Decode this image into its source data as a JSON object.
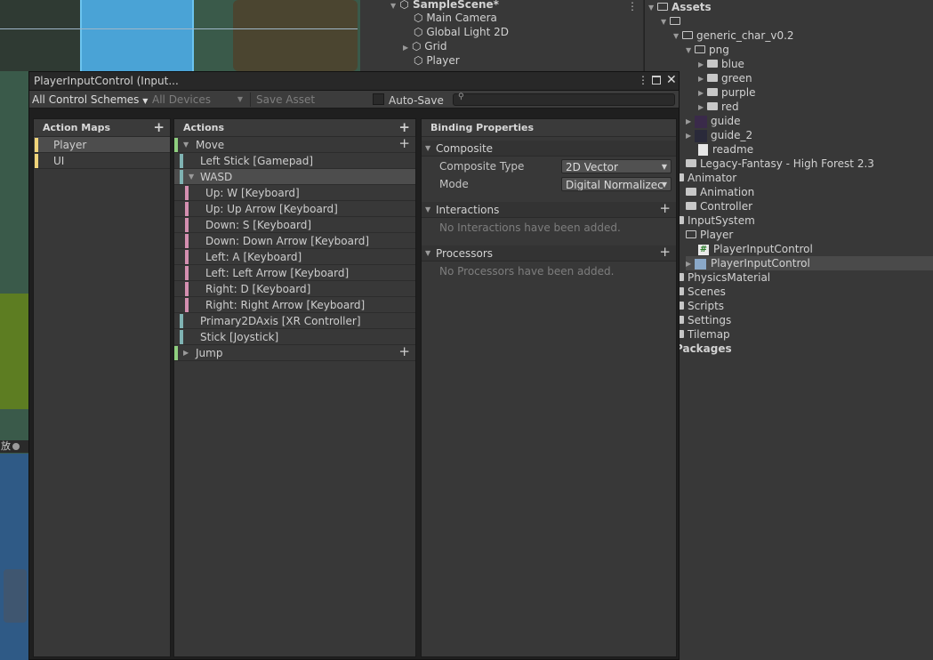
{
  "hierarchy": {
    "scene": "SampleScene*",
    "items": [
      "Main Camera",
      "Global Light 2D",
      "Grid",
      "Player"
    ]
  },
  "project": {
    "root": "Assets",
    "items": [
      {
        "label": ""
      },
      {
        "label": "generic_char_v0.2"
      },
      {
        "label": "png"
      },
      {
        "label": "blue"
      },
      {
        "label": "green"
      },
      {
        "label": "purple"
      },
      {
        "label": "red"
      },
      {
        "label": "guide"
      },
      {
        "label": "guide_2"
      },
      {
        "label": "readme"
      },
      {
        "label": "Legacy-Fantasy - High Forest 2.3"
      },
      {
        "label": "Animator"
      },
      {
        "label": "Animation"
      },
      {
        "label": "Controller"
      },
      {
        "label": "InputSystem"
      },
      {
        "label": "Player"
      },
      {
        "label": "PlayerInputControl"
      },
      {
        "label": "PlayerInputControl"
      },
      {
        "label": "PhysicsMaterial"
      },
      {
        "label": "Scenes"
      },
      {
        "label": "Scripts"
      },
      {
        "label": "Settings"
      },
      {
        "label": "Tilemap"
      },
      {
        "label": "Packages"
      }
    ]
  },
  "scene_view": {
    "side_label": "放"
  },
  "window": {
    "title": "PlayerInputControl (Input...",
    "toolbar": {
      "control_schemes": "All Control Schemes",
      "devices": "All Devices",
      "save_asset": "Save Asset",
      "auto_save": "Auto-Save",
      "search_value": ""
    },
    "action_maps": {
      "header": "Action Maps",
      "items": [
        "Player",
        "UI"
      ],
      "selected": "Player"
    },
    "actions": {
      "header": "Actions",
      "rows": [
        {
          "label": "Move",
          "kind": "action"
        },
        {
          "label": "Left Stick [Gamepad]",
          "kind": "binding"
        },
        {
          "label": "WASD",
          "kind": "composite"
        },
        {
          "label": "Up: W [Keyboard]",
          "kind": "part"
        },
        {
          "label": "Up: Up Arrow [Keyboard]",
          "kind": "part"
        },
        {
          "label": "Down: S [Keyboard]",
          "kind": "part"
        },
        {
          "label": "Down: Down Arrow [Keyboard]",
          "kind": "part"
        },
        {
          "label": "Left: A [Keyboard]",
          "kind": "part"
        },
        {
          "label": "Left: Left Arrow [Keyboard]",
          "kind": "part"
        },
        {
          "label": "Right: D [Keyboard]",
          "kind": "part"
        },
        {
          "label": "Right: Right Arrow [Keyboard]",
          "kind": "part"
        },
        {
          "label": "Primary2DAxis [XR Controller]",
          "kind": "binding"
        },
        {
          "label": "Stick [Joystick]",
          "kind": "binding"
        },
        {
          "label": "Jump",
          "kind": "action"
        }
      ]
    },
    "binding": {
      "header": "Binding Properties",
      "composite": {
        "title": "Composite",
        "type_label": "Composite Type",
        "type_value": "2D Vector",
        "mode_label": "Mode",
        "mode_value": "Digital Normalizec"
      },
      "interactions": {
        "title": "Interactions",
        "empty": "No Interactions have been added."
      },
      "processors": {
        "title": "Processors",
        "empty": "No Processors have been added."
      }
    }
  },
  "colors": {
    "action_bar": "#8fcf7f",
    "binding_bar": "#7fb3b3",
    "part_bar": "#d48fb0",
    "map_bar": "#f0d47a",
    "selected_row": "#4d4d4d"
  }
}
